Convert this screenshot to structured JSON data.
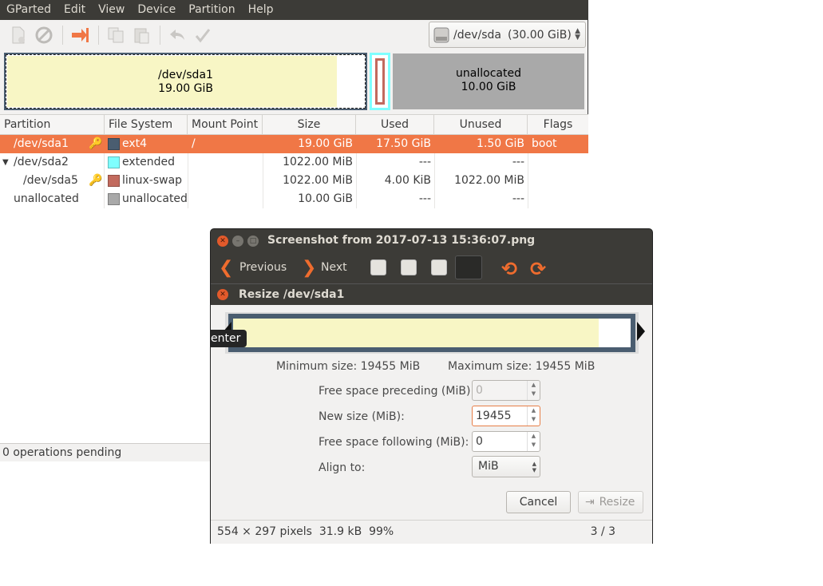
{
  "gparted": {
    "menu": [
      "GParted",
      "Edit",
      "View",
      "Device",
      "Partition",
      "Help"
    ],
    "toolbar_icons": [
      "new-icon",
      "delete-icon",
      "resize-move-icon",
      "copy-icon",
      "paste-icon",
      "undo-icon",
      "apply-icon"
    ],
    "device": {
      "path": "/dev/sda",
      "size": "(30.00 GiB)"
    },
    "map": {
      "sda1": {
        "name": "/dev/sda1",
        "size": "19.00 GiB"
      },
      "unallocated": {
        "name": "unallocated",
        "size": "10.00 GiB"
      }
    },
    "columns": [
      "Partition",
      "File System",
      "Mount Point",
      "Size",
      "Used",
      "Unused",
      "Flags"
    ],
    "rows": [
      {
        "partition": "/dev/sda1",
        "fs": "ext4",
        "fs_color": "#4a5d70",
        "mount": "/",
        "size": "19.00 GiB",
        "used": "17.50 GiB",
        "unused": "1.50 GiB",
        "flags": "boot",
        "selected": true
      },
      {
        "partition": "/dev/sda2",
        "fs": "extended",
        "fs_color": "#7fffff",
        "mount": "",
        "size": "1022.00 MiB",
        "used": "---",
        "unused": "---",
        "flags": ""
      },
      {
        "partition": "/dev/sda5",
        "fs": "linux-swap",
        "fs_color": "#c26a5e",
        "mount": "",
        "size": "1022.00 MiB",
        "used": "4.00 KiB",
        "unused": "1022.00 MiB",
        "flags": ""
      },
      {
        "partition": "unallocated",
        "fs": "unallocated",
        "fs_color": "#a9a9a9",
        "mount": "",
        "size": "10.00 GiB",
        "used": "---",
        "unused": "---",
        "flags": ""
      }
    ],
    "status": "0 operations pending"
  },
  "viewer": {
    "title": "Screenshot from 2017-07-13 15:36:07.png",
    "prev_label": "Previous",
    "next_label": "Next",
    "info": "554 × 297 pixels  31.9 kB  99%",
    "position": "3 / 3"
  },
  "dialog": {
    "title": "Resize /dev/sda1",
    "tooltip": "enter",
    "min_size": "Minimum size: 19455 MiB",
    "max_size": "Maximum size: 19455 MiB",
    "fields": {
      "preceding_label": "Free space preceding (MiB):",
      "preceding_value": "0",
      "newsize_label": "New size (MiB):",
      "newsize_value": "19455",
      "following_label": "Free space following (MiB):",
      "following_value": "0",
      "align_label": "Align to:",
      "align_value": "MiB"
    },
    "cancel_label": "Cancel",
    "resize_label": "Resize"
  }
}
